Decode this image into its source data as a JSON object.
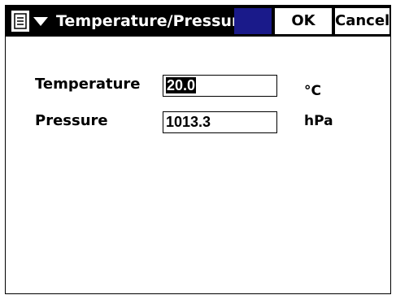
{
  "window": {
    "title": "Temperature/Pressure",
    "menu_icon": "menu-icon",
    "ok_label": "OK",
    "cancel_label": "Cancel"
  },
  "form": {
    "temperature": {
      "label": "Temperature",
      "value": "20.0",
      "unit": "°C"
    },
    "pressure": {
      "label": "Pressure",
      "value": "1013.3",
      "unit": "hPa"
    }
  }
}
